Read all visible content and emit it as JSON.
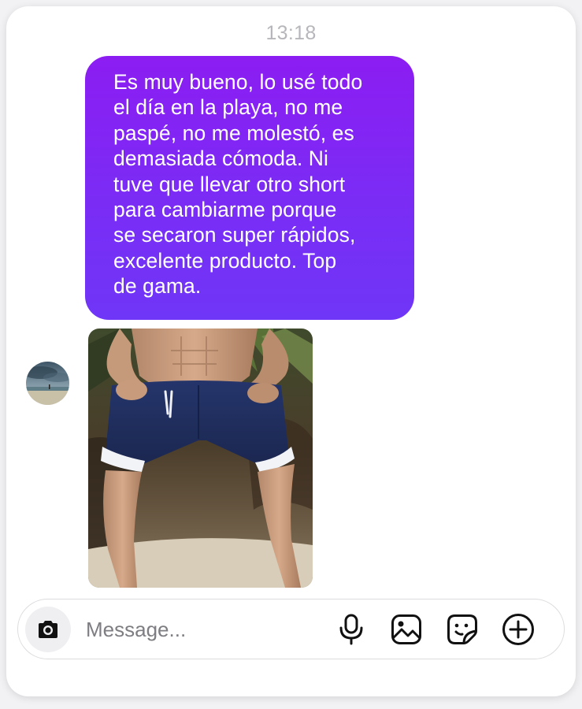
{
  "thread": {
    "timestamp": "13:18",
    "message_text": "Es muy bueno, lo usé todo el día en la playa, no me paspé, no me molestó, es demasiada cómoda. Ni tuve que llevar otro short para cambiarme porque se secaron super rápidos, excelente producto. Top de gama.",
    "message_lines": [
      "Es muy bueno, lo usé todo",
      "el día en la playa, no me",
      "paspé, no me molestó, es",
      "demasiada cómoda. Ni",
      "tuve que llevar otro short",
      "para cambiarme porque",
      "se secaron super rápidos,",
      "excelente producto. Top",
      "de gama."
    ]
  },
  "composer": {
    "placeholder": "Message...",
    "icons": [
      "camera-icon",
      "microphone-icon",
      "gallery-icon",
      "sticker-icon",
      "plus-circle-icon"
    ]
  },
  "colors": {
    "bubble_gradient_top": "#8c1df2",
    "bubble_gradient_bottom": "#6f36f7",
    "timestamp": "#b7b7bb",
    "icon": "#111111",
    "shorts": "#1f2d5c"
  }
}
